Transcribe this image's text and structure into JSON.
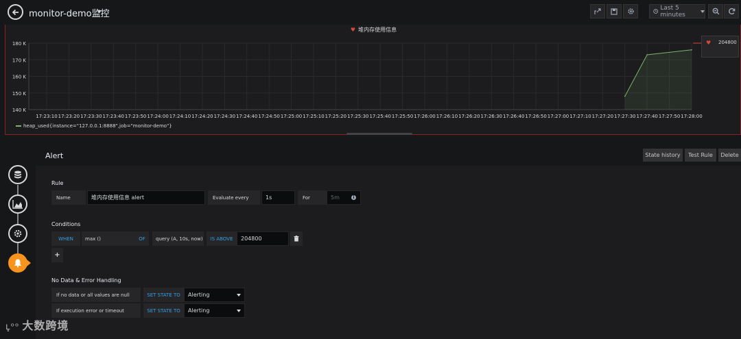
{
  "topbar": {
    "dashboard_title": "monitor-demo监控",
    "time_range": "Last 5 minutes"
  },
  "panel": {
    "title": "堆内存使用信息",
    "legend": "heap_used{instance=\"127.0.0.1:8888\",job=\"monitor-demo\"}",
    "threshold_value": "204800"
  },
  "chart_data": {
    "type": "area",
    "title": "堆内存使用信息",
    "ytick_labels": [
      "180 K",
      "170 K",
      "160 K",
      "150 K",
      "140 K"
    ],
    "yticks": [
      180000,
      170000,
      160000,
      150000,
      140000
    ],
    "ylim": [
      140000,
      180000
    ],
    "xtick_labels": [
      "17:23:10",
      "17:23:20",
      "17:23:30",
      "17:23:40",
      "17:23:50",
      "17:24:00",
      "17:24:10",
      "17:24:20",
      "17:24:30",
      "17:24:40",
      "17:24:50",
      "17:25:00",
      "17:25:10",
      "17:25:20",
      "17:25:30",
      "17:25:40",
      "17:25:50",
      "17:26:00",
      "17:26:10",
      "17:26:20",
      "17:26:30",
      "17:26:40",
      "17:26:50",
      "17:27:00",
      "17:27:10",
      "17:27:20",
      "17:27:30",
      "17:27:40",
      "17:27:50",
      "17:28:00"
    ],
    "series": [
      {
        "name": "heap_used{instance=\"127.0.0.1:8888\",job=\"monitor-demo\"}",
        "x": [
          "17:27:30",
          "17:27:40",
          "17:28:00"
        ],
        "values": [
          148000,
          173000,
          176000
        ],
        "color": "#7eb26d"
      }
    ],
    "grid": true,
    "legend_position": "bottom-left"
  },
  "alert": {
    "title": "Alert",
    "buttons": {
      "state_history": "State history",
      "test_rule": "Test Rule",
      "delete": "Delete"
    },
    "rule": {
      "section": "Rule",
      "name_label": "Name",
      "name_value": "堆内存使用信息 alert",
      "evaluate_label": "Evaluate every",
      "evaluate_value": "1s",
      "for_label": "For",
      "for_placeholder": "5m"
    },
    "conditions": {
      "section": "Conditions",
      "when": "WHEN",
      "reducer": "max ()",
      "of": "OF",
      "query": "query (A, 10s, now)",
      "is_above": "IS ABOVE",
      "threshold": "204800"
    },
    "nodata": {
      "section": "No Data & Error Handling",
      "row1_label": "If no data or all values are null",
      "row1_kw": "SET STATE TO",
      "row1_value": "Alerting",
      "row2_label": "If execution error or timeout",
      "row2_kw": "SET STATE TO",
      "row2_value": "Alerting"
    }
  },
  "watermark": "大数跨境"
}
